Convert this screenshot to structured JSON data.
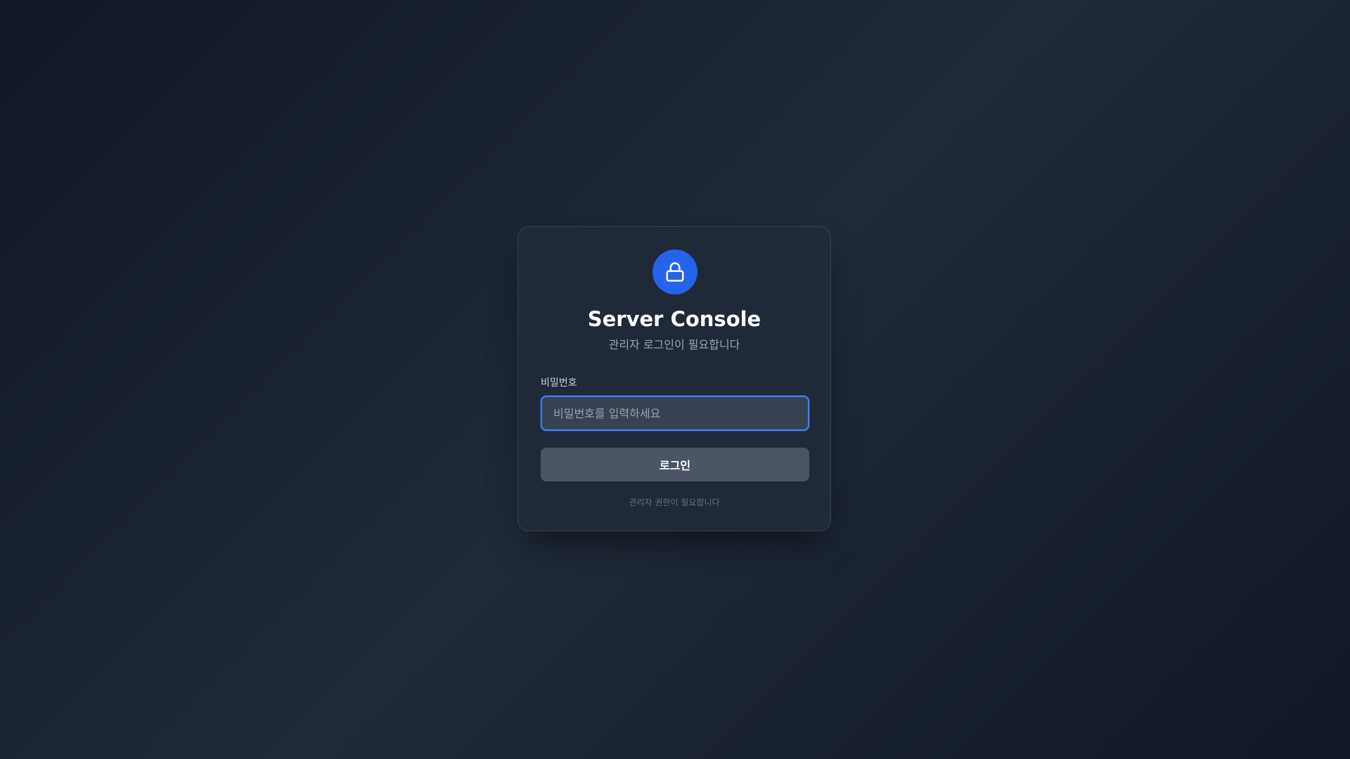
{
  "card": {
    "lock_icon": "lock-icon",
    "title": "Server Console",
    "subtitle": "관리자 로그인이 필요합니다",
    "password": {
      "label": "비밀번호",
      "value": "",
      "placeholder": "비밀번호를 입력하세요"
    },
    "login_label": "로그인",
    "footer_note": "관리자 권한이 필요합니다"
  },
  "colors": {
    "accent": "#2563eb",
    "focus_border": "#3b82f6",
    "card_background": "#1f2937",
    "button_background": "#4b5563"
  }
}
